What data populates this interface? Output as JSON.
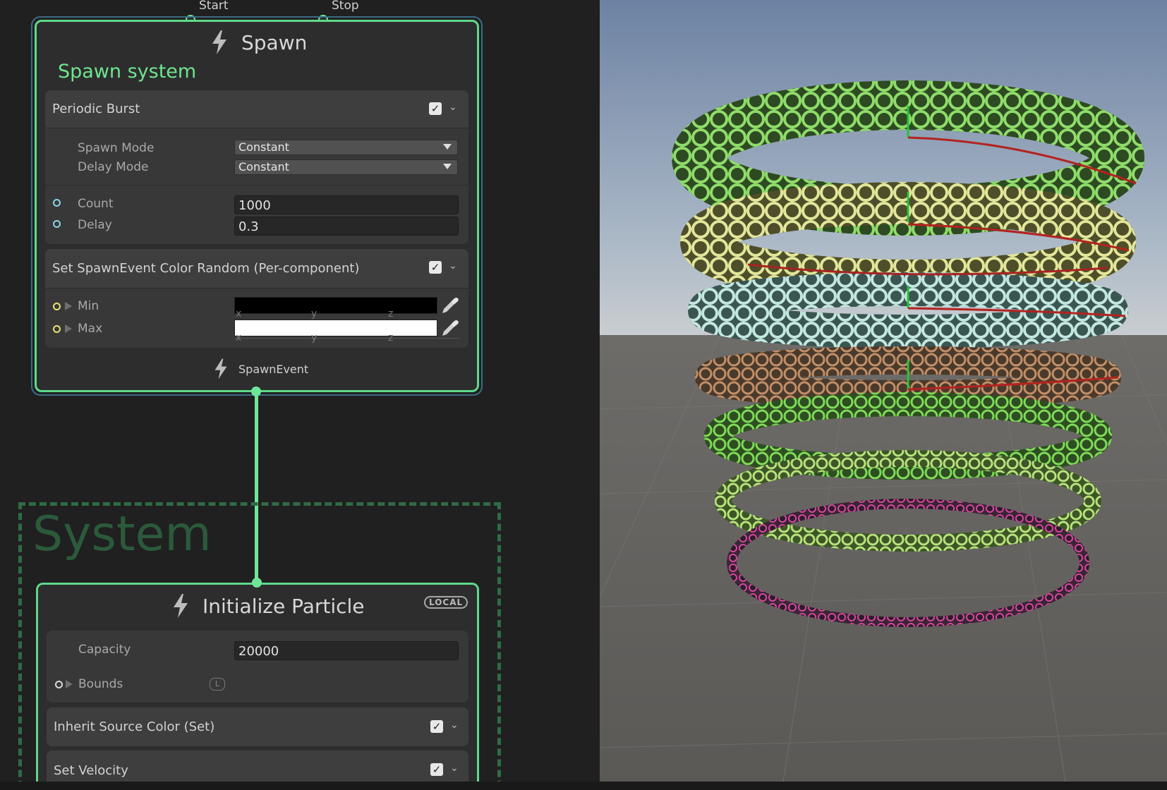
{
  "graph": {
    "flow_ports": {
      "start": "Start",
      "stop": "Stop"
    },
    "spawn_context": {
      "title": "Spawn",
      "system_name": "Spawn system",
      "blocks": {
        "periodic_burst": {
          "title": "Periodic Burst",
          "enabled": true,
          "spawn_mode": {
            "label": "Spawn Mode",
            "value": "Constant"
          },
          "delay_mode": {
            "label": "Delay Mode",
            "value": "Constant"
          },
          "count": {
            "label": "Count",
            "value": "1000"
          },
          "delay": {
            "label": "Delay",
            "value": "0.3"
          }
        },
        "set_color": {
          "title": "Set SpawnEvent Color Random (Per-component)",
          "enabled": true,
          "min": {
            "label": "Min",
            "color": "#000000"
          },
          "max": {
            "label": "Max",
            "color": "#ffffff"
          },
          "axes": [
            "x",
            "y",
            "z"
          ]
        }
      },
      "output": "SpawnEvent"
    },
    "system_group": {
      "title": "System"
    },
    "init_context": {
      "title": "Initialize Particle",
      "space_badge": "LOCAL",
      "capacity": {
        "label": "Capacity",
        "value": "20000"
      },
      "bounds": {
        "label": "Bounds",
        "badge": "L"
      },
      "blocks": [
        {
          "title": "Inherit Source Color (Set)",
          "enabled": true
        },
        {
          "title": "Set Velocity",
          "enabled": true
        }
      ]
    }
  },
  "colors": {
    "flow_green": "#6fe59a",
    "spawn_title": "#6ee58f",
    "group_dashes": "#2f6b45",
    "ring_green": "#6fcf5a",
    "ring_yellow": "#d5d97e",
    "ring_pale_blue": "#a9d3cc",
    "ring_brown": "#a07a5c",
    "ring_pink": "#c23a8d"
  },
  "icons": [
    "lightning-icon",
    "checkmark-icon",
    "chevron-down-icon",
    "dropdown-arrow-icon",
    "eyedropper-icon",
    "expand-triangle-icon"
  ]
}
